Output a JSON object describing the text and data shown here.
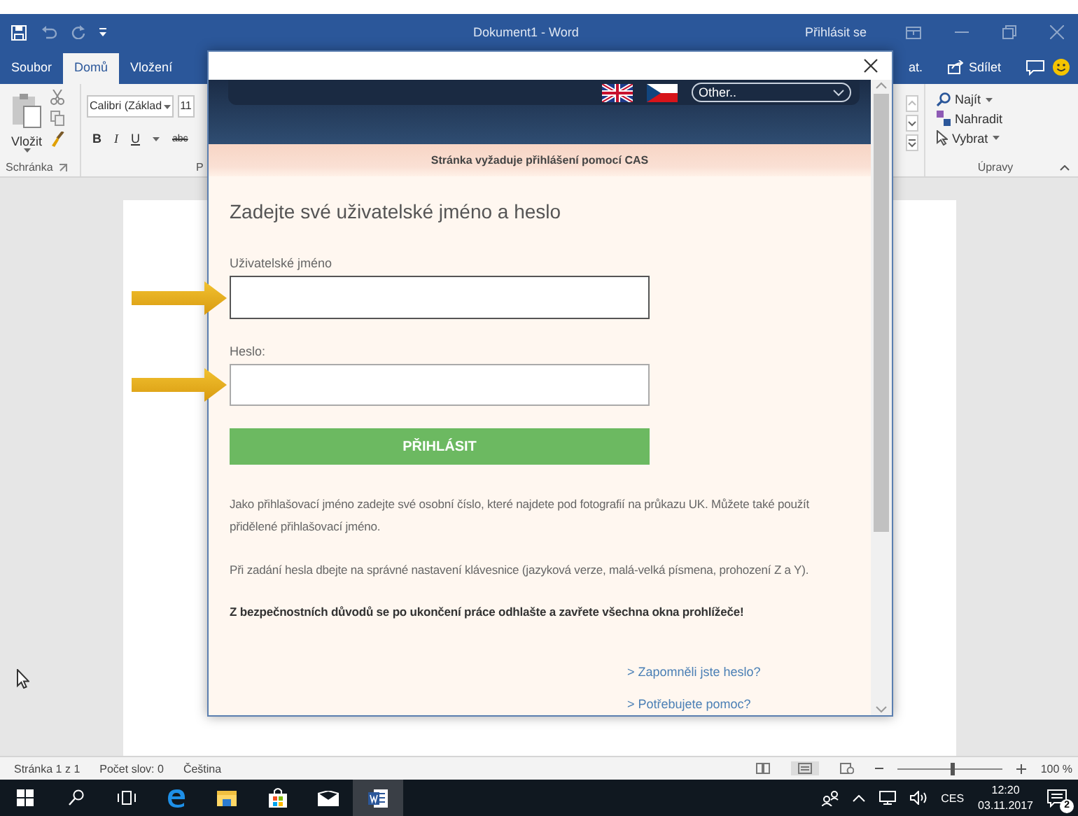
{
  "title_bar": {
    "title": "Dokument1  -  Word",
    "sign_in": "Přihlásit se"
  },
  "ribbon_tabs": [
    {
      "label": "Soubor",
      "selected": false
    },
    {
      "label": "Domů",
      "selected": true
    },
    {
      "label": "Vložení",
      "selected": false
    }
  ],
  "ribbon_tabs_right": {
    "partial_tab": "at.",
    "share": "Sdílet"
  },
  "ribbon": {
    "paste_label": "Vložit",
    "clipboard_group": "Schránka",
    "font_name": "Calibri (Základ",
    "font_size": "11",
    "font_group": "P",
    "format_buttons": [
      {
        "label": "B",
        "kind": "bold"
      },
      {
        "label": "I",
        "kind": "italic"
      },
      {
        "label": "U",
        "kind": "underline"
      },
      {
        "label": "abc",
        "kind": "strike"
      }
    ],
    "find": "Najít",
    "replace": "Nahradit",
    "select": "Vybrat",
    "editing_group": "Úpravy"
  },
  "dialog": {
    "language_select": "Other..",
    "notice": "Stránka vyžaduje přihlášení pomocí CAS",
    "heading": "Zadejte své uživatelské jméno a heslo",
    "fields": [
      {
        "label": "Uživatelské jméno",
        "highlighted": true
      },
      {
        "label": "Heslo:",
        "highlighted": true
      }
    ],
    "submit": "PŘIHLÁSIT",
    "paragraphs": [
      {
        "text": "Jako přihlašovací jméno zadejte své osobní číslo, které najdete pod fotografií na průkazu UK. Můžete také použít přidělené přihlašovací jméno.",
        "bold": false
      },
      {
        "text": "Při zadání hesla dbejte na správné nastavení klávesnice (jazyková verze, malá-velká písmena, prohození Z a Y).",
        "bold": false
      },
      {
        "text": "Z bezpečnostních důvodů se po ukončení práce odhlašte a zavřete všechna okna prohlížeče!",
        "bold": true
      }
    ],
    "links": [
      {
        "text": "> Zapomněli jste heslo?"
      },
      {
        "text": "> Potřebujete pomoc?"
      }
    ]
  },
  "status_bar": {
    "items": [
      "Stránka 1 z 1",
      "Počet slov: 0",
      "Čeština"
    ],
    "zoom": {
      "level": 0.5,
      "reading": "100 %"
    }
  },
  "taskbar": {
    "input_language": "CES",
    "time": "12:20",
    "date": "03.11.2017",
    "notifications": "2"
  }
}
